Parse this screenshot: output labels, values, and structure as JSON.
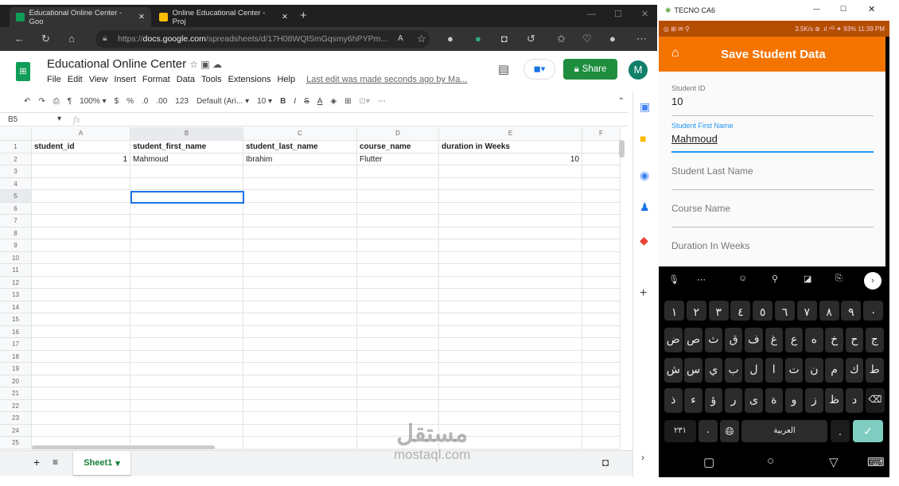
{
  "browser": {
    "tabs": [
      {
        "title": "Educational Online Center - Goo",
        "active": true,
        "color": "#0f9d58"
      },
      {
        "title": "Online Educational Center - Proj",
        "active": false,
        "color": "#fbbc04"
      }
    ],
    "url_prefix": "https://",
    "url_domain": "docs.google.com",
    "url_rest": "/spreadsheets/d/17H08WQlSmGqsmy6hPYPm..."
  },
  "sheets": {
    "title": "Educational Online Center",
    "menu": [
      "File",
      "Edit",
      "View",
      "Insert",
      "Format",
      "Data",
      "Tools",
      "Extensions",
      "Help"
    ],
    "last_edit": "Last edit was made seconds ago by Ma...",
    "share": "Share",
    "avatar": "M",
    "toolbar": {
      "zoom": "100%",
      "currency": "$",
      "percent": "%",
      "dec_less": ".0",
      "dec_more": ".00",
      "format": "123",
      "font": "Default (Ari...",
      "size": "10",
      "bold": "B",
      "italic": "I",
      "strike": "S",
      "textcolor": "A"
    },
    "name_box": "B5",
    "fx": "fx",
    "columns": [
      "A",
      "B",
      "C",
      "D",
      "E",
      "F"
    ],
    "rows": [
      [
        "student_id",
        "student_first_name",
        "student_last_name",
        "course_name",
        "duration in Weeks",
        ""
      ],
      [
        "1",
        "Mahmoud",
        "Ibrahim",
        "Flutter",
        "10",
        ""
      ]
    ],
    "row_count": 24,
    "sheet_tab": "Sheet1"
  },
  "phone": {
    "device": "TECNO CA6",
    "status_left": "◎ ⊞ ✉ ⚲",
    "status_right": "3.5K/s ⊛ .ıl ⁴ᴳ ✦ 93% 11:39 PM",
    "app_title": "Save Student Data",
    "fields": [
      {
        "label": "Student ID",
        "value": "10"
      },
      {
        "label": "Student First Name",
        "value": "Mahmoud"
      },
      {
        "label": "Student Last Name"
      },
      {
        "label": "Course Name"
      },
      {
        "label": "Duration In Weeks"
      }
    ],
    "keyboard": {
      "rows": [
        [
          "١",
          "٢",
          "٣",
          "٤",
          "٥",
          "٦",
          "٧",
          "٨",
          "٩",
          "٠"
        ],
        [
          "ض",
          "ص",
          "ث",
          "ق",
          "ف",
          "غ",
          "ع",
          "ه",
          "خ",
          "ح",
          "ج"
        ],
        [
          "ش",
          "س",
          "ي",
          "ب",
          "ل",
          "ا",
          "ت",
          "ن",
          "م",
          "ك",
          "ط"
        ],
        [
          "ذ",
          "ء",
          "ؤ",
          "ر",
          "ى",
          "ة",
          "و",
          "ز",
          "ظ",
          "د"
        ]
      ],
      "numbers": "٢٣١",
      "space": "العربية",
      "period": "."
    },
    "accent": "#f57400",
    "focus_color": "#2196f3"
  },
  "watermark": {
    "arabic": "مستقل",
    "latin": "mostaql.com"
  }
}
